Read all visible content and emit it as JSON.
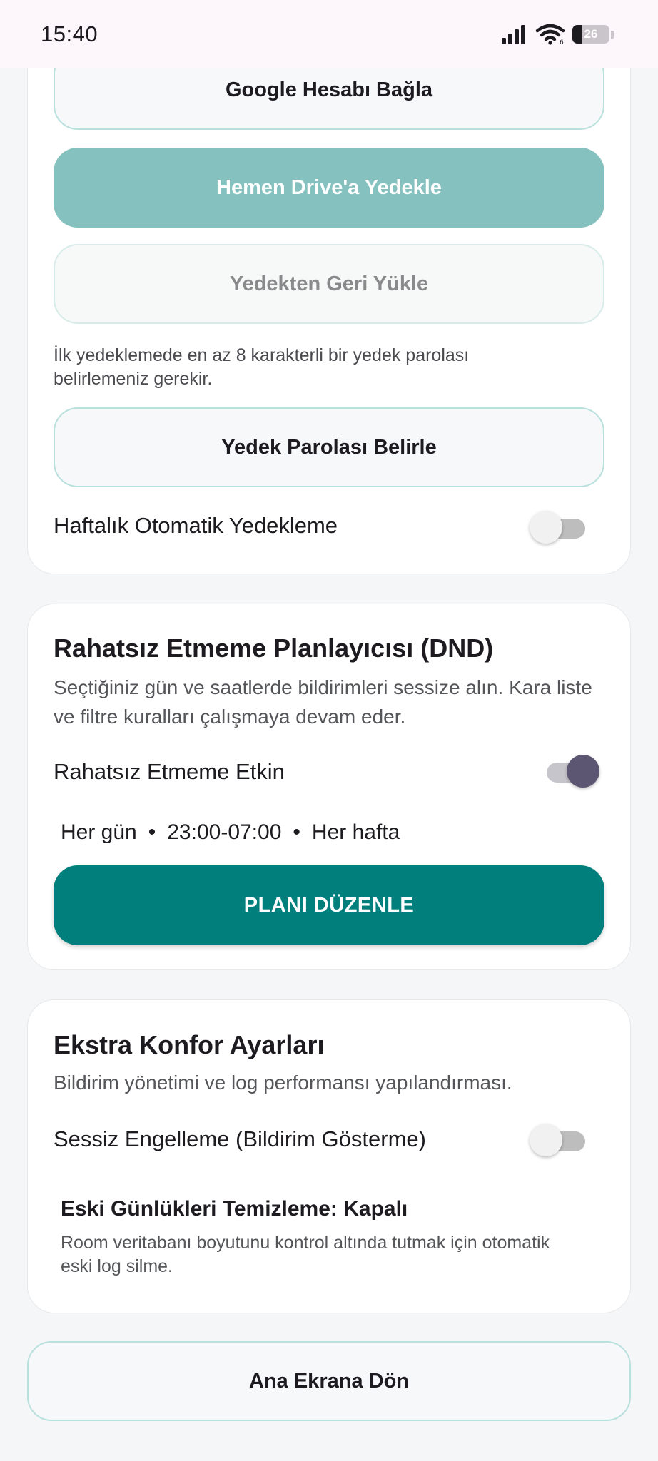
{
  "status_bar": {
    "time": "15:40",
    "battery_level": "26",
    "icons": [
      "signal-icon",
      "wifi-icon",
      "battery-icon"
    ]
  },
  "backup_card": {
    "connect_google": "Google Hesabı Bağla",
    "backup_now": "Hemen Drive'a Yedekle",
    "restore": "Yedekten Geri Yükle",
    "password_hint": "İlk yedeklemede en az 8 karakterli bir yedek parolası belirlemeniz gerekir.",
    "set_password": "Yedek Parolası Belirle",
    "weekly_backup_label": "Haftalık Otomatik Yedekleme",
    "weekly_backup_enabled": false
  },
  "dnd_card": {
    "title": "Rahatsız Etmeme Planlayıcısı (DND)",
    "description": "Seçtiğiniz gün ve saatlerde bildirimleri sessize alın. Kara liste ve filtre kuralları çalışmaya devam eder.",
    "enabled_label": "Rahatsız Etmeme Etkin",
    "enabled": true,
    "schedule_days": "Her gün",
    "schedule_time": "23:00-07:00",
    "schedule_repeat": "Her hafta",
    "separator": "•",
    "edit_button": "PLANI DÜZENLE"
  },
  "comfort_card": {
    "title": "Ekstra Konfor Ayarları",
    "description": "Bildirim yönetimi ve log performansı yapılandırması.",
    "silent_block_label": "Sessiz Engelleme (Bildirim Gösterme)",
    "silent_block_enabled": false,
    "cleanup_title": "Eski Günlükleri Temizleme: Kapalı",
    "cleanup_desc": "Room veritabanı boyutunu kontrol altında tutmak için otomatik eski log silme."
  },
  "footer": {
    "home_button": "Ana Ekrana Dön"
  },
  "colors": {
    "primary": "#007f7c",
    "primary_disabled": "#84c1bf",
    "toggle_on_thumb": "#5d5672",
    "outline": "#b8e0dc"
  }
}
